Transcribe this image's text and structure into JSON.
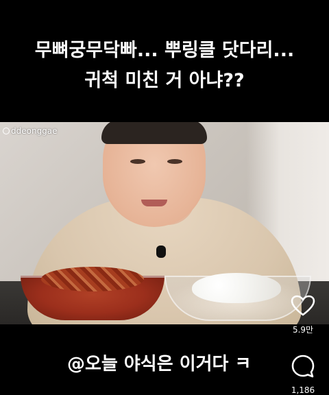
{
  "top_caption": {
    "line1": "무뼈궁무닥빠... 뿌링클 닷다리...",
    "line2": "귀척 미친 거 아냐??"
  },
  "video": {
    "watermark": "ddeonggae"
  },
  "bottom_caption": "@오늘 야식은 이거다 ㅋ",
  "actions": {
    "like_count": "5.9만",
    "comment_count": "1,186"
  },
  "colors": {
    "background": "#000000",
    "text": "#ffffff"
  }
}
